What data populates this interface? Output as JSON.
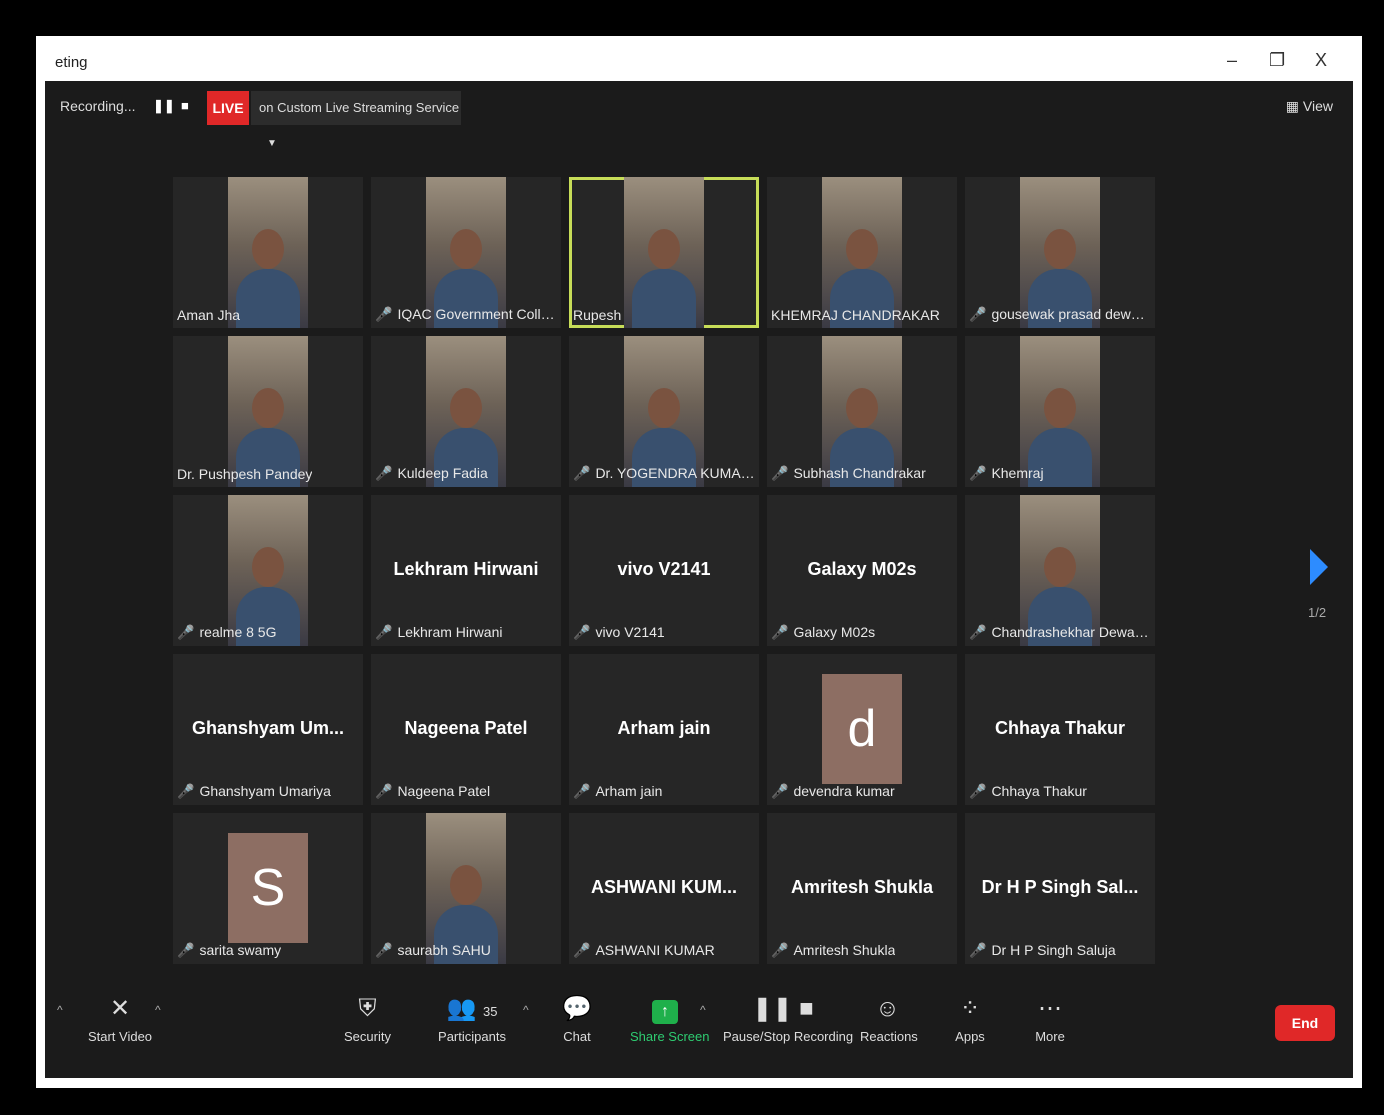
{
  "window": {
    "title": "eting",
    "minimize": "–",
    "restore": "❐",
    "close": "X"
  },
  "top_toolbar": {
    "recording_status": "Recording...",
    "pause_icon": "❚❚",
    "stop_icon": "■",
    "live_label": "LIVE",
    "live_service": "on Custom Live Streaming Service",
    "view_label": "View"
  },
  "participants": [
    {
      "label": "Aman Jha",
      "kind": "video",
      "muted": false
    },
    {
      "label": "IQAC Government College ...",
      "kind": "video",
      "muted": true
    },
    {
      "label": "Rupesh",
      "kind": "video",
      "muted": false,
      "active": true
    },
    {
      "label": "KHEMRAJ CHANDRAKAR",
      "kind": "video",
      "muted": false
    },
    {
      "label": "gousewak prasad dewangan",
      "kind": "video",
      "muted": true
    },
    {
      "label": "Dr. Pushpesh Pandey",
      "kind": "video",
      "muted": false
    },
    {
      "label": "Kuldeep Fadia",
      "kind": "video",
      "muted": true
    },
    {
      "label": "Dr. YOGENDRA KUMAR D...",
      "kind": "video",
      "muted": true
    },
    {
      "label": "Subhash Chandrakar",
      "kind": "video",
      "muted": true
    },
    {
      "label": "Khemraj",
      "kind": "video",
      "muted": true
    },
    {
      "label": "realme 8 5G",
      "kind": "video",
      "muted": true
    },
    {
      "label": "Lekhram Hirwani",
      "kind": "name",
      "display": "Lekhram Hirwani",
      "muted": true
    },
    {
      "label": "vivo V2141",
      "kind": "name",
      "display": "vivo V2141",
      "muted": true
    },
    {
      "label": "Galaxy M02s",
      "kind": "name",
      "display": "Galaxy M02s",
      "muted": true
    },
    {
      "label": "Chandrashekhar Dewangan",
      "kind": "video",
      "muted": true
    },
    {
      "label": "Ghanshyam Umariya",
      "kind": "name",
      "display": "Ghanshyam Um...",
      "muted": true
    },
    {
      "label": "Nageena Patel",
      "kind": "name",
      "display": "Nageena Patel",
      "muted": true
    },
    {
      "label": "Arham jain",
      "kind": "name",
      "display": "Arham jain",
      "muted": true
    },
    {
      "label": "devendra kumar",
      "kind": "avatar",
      "initial": "d",
      "muted": true
    },
    {
      "label": "Chhaya Thakur",
      "kind": "name",
      "display": "Chhaya Thakur",
      "muted": true
    },
    {
      "label": "sarita swamy",
      "kind": "avatar",
      "initial": "S",
      "muted": true
    },
    {
      "label": "saurabh SAHU",
      "kind": "video",
      "muted": true
    },
    {
      "label": "ASHWANI KUMAR",
      "kind": "name",
      "display": "ASHWANI KUM...",
      "muted": true
    },
    {
      "label": "Amritesh Shukla",
      "kind": "name",
      "display": "Amritesh Shukla",
      "muted": true
    },
    {
      "label": "Dr H P Singh Saluja",
      "kind": "name",
      "display": "Dr H P Singh Sal...",
      "muted": true
    }
  ],
  "pagination": {
    "indicator": "1/2"
  },
  "bottom_toolbar": {
    "start_video": "Start Video",
    "security": "Security",
    "participants": "Participants",
    "participant_count": "35",
    "chat": "Chat",
    "share_screen": "Share Screen",
    "pause_stop_recording": "Pause/Stop Recording",
    "reactions": "Reactions",
    "apps": "Apps",
    "more": "More",
    "end": "End"
  },
  "colors": {
    "live_red": "#e02828",
    "active_speaker": "#c7dd58",
    "share_green": "#1fb04b",
    "next_arrow": "#2d8cff"
  }
}
